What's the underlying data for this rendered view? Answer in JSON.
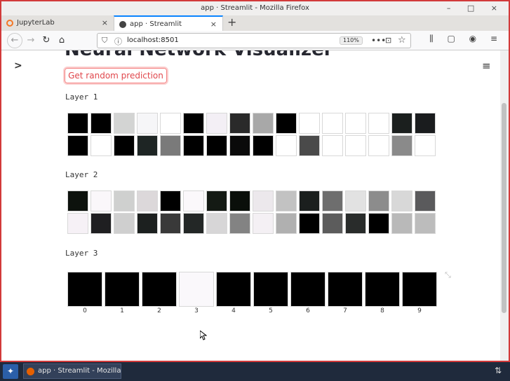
{
  "window": {
    "title": "app · Streamlit - Mozilla Firefox",
    "controls": "– □ ×"
  },
  "tabs": [
    {
      "label": "JupyterLab",
      "close": "×",
      "favicon_color": "#f37726"
    },
    {
      "label": "app · Streamlit",
      "close": "×",
      "favicon_color": "#444444"
    }
  ],
  "new_tab": "+",
  "navbar": {
    "back": "←",
    "forward": "→",
    "reload": "↻",
    "home": "⌂",
    "shield": "⛉",
    "info": "ⓘ",
    "url": "localhost:8501",
    "zoom": "110%",
    "dots": "•••",
    "pocket": "⊡",
    "star": "☆",
    "right_icons": "⫼ ▢ ◉ ≡"
  },
  "app": {
    "sidebar_toggle": ">",
    "menu": "≡",
    "title": "Neural Network Visualizer",
    "button_label": "Get random prediction",
    "expand": "⤡",
    "layers": [
      {
        "label": "Layer 1",
        "rows": [
          [
            "#000000",
            "#000000",
            "#d3d4d3",
            "#f6f6f8",
            "#ffffff",
            "#000000",
            "#f3eff5",
            "#2a2a2a",
            "#a8a8a8",
            "#000000",
            "#ffffff",
            "#ffffff",
            "#ffffff",
            "#ffffff",
            "#1b1f1e",
            "#1a1c1e"
          ],
          [
            "#000000",
            "#ffffff",
            "#000000",
            "#1e2524",
            "#7a7a7a",
            "#000000",
            "#000000",
            "#0a0a0a",
            "#000000",
            "#ffffff",
            "#4a4a4a",
            "#ffffff",
            "#ffffff",
            "#ffffff",
            "#8a8a8a",
            "#ffffff"
          ]
        ]
      },
      {
        "label": "Layer 2",
        "rows": [
          [
            "#0d120d",
            "#faf7fa",
            "#cfd0cf",
            "#dcd8da",
            "#000000",
            "#fbf8fb",
            "#141a14",
            "#0a0f0a",
            "#ece8ec",
            "#c2c2c2",
            "#1b1f1e",
            "#6e6e6e",
            "#e2e2e2",
            "#8c8c8c",
            "#d8d8d8",
            "#5a5a5c"
          ],
          [
            "#f6f1f6",
            "#1f1f21",
            "#cfcfcf",
            "#1c201f",
            "#393939",
            "#232726",
            "#d7d6d7",
            "#838383",
            "#f4f0f4",
            "#b0b0b0",
            "#000000",
            "#5c5c5c",
            "#292c2b",
            "#000000",
            "#b9b9b9",
            "#bcbcbc"
          ]
        ]
      },
      {
        "label": "Layer 3",
        "outputs": [
          {
            "label": "0",
            "color": "#000000"
          },
          {
            "label": "1",
            "color": "#000000"
          },
          {
            "label": "2",
            "color": "#000000"
          },
          {
            "label": "3",
            "color": "#faf8fb"
          },
          {
            "label": "4",
            "color": "#000000"
          },
          {
            "label": "5",
            "color": "#000000"
          },
          {
            "label": "6",
            "color": "#000000"
          },
          {
            "label": "7",
            "color": "#000000"
          },
          {
            "label": "8",
            "color": "#000000"
          },
          {
            "label": "9",
            "color": "#000000"
          }
        ]
      }
    ]
  },
  "taskbar": {
    "start": "✦",
    "task_label": "app · Streamlit - Mozilla Firef...",
    "tray": "⇅"
  }
}
